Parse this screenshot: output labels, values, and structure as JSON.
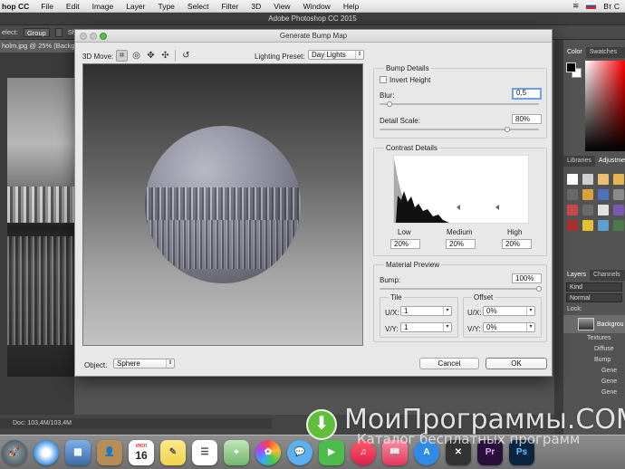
{
  "menubar": {
    "app": "hop CC",
    "items": [
      "File",
      "Edit",
      "Image",
      "Layer",
      "Type",
      "Select",
      "Filter",
      "3D",
      "View",
      "Window",
      "Help"
    ],
    "right_text": "Вт С"
  },
  "ps": {
    "title": "Adobe Photoshop CC 2015",
    "options": {
      "select_label": "elect:",
      "select_value": "Group",
      "show_label": "Sho"
    },
    "doc_tab": "holm.jpg @ 25% (Backgro",
    "status": "Doc: 103,4M/103,4M"
  },
  "panels": {
    "color_tabs": [
      "Color",
      "Swatches"
    ],
    "adjust_tabs": [
      "Libraries",
      "Adjustmen"
    ],
    "layers_tabs": [
      "Layers",
      "Channels"
    ],
    "layers_kind": "Kind",
    "layers_blend": "Normal",
    "layers_lock": "Lock:",
    "layer_background": "Backgrou",
    "layer_sub": [
      "Textures",
      "Diffuse",
      "Bump",
      "Gene",
      "Gene",
      "Gene"
    ],
    "adjust_colors": [
      "#ffffff",
      "#cfcfcf",
      "#e8c070",
      "#e6b450",
      "#6a6a6a",
      "#d9a03c",
      "#4f6fbf",
      "#8a8a8a",
      "#c84a4a",
      "#6b6b6b",
      "#e0e0e0",
      "#7a5ab0",
      "#aa3030",
      "#e6c030",
      "#5ba0d0",
      "#4a7a4a"
    ]
  },
  "dialog": {
    "title": "Generate Bump Map",
    "move_label": "3D Move:",
    "lighting_label": "Lighting Preset:",
    "lighting_value": "Day Lights",
    "object_label": "Object:",
    "object_value": "Sphere",
    "cancel": "Cancel",
    "ok": "OK",
    "bump_details": {
      "title": "Bump Details",
      "invert_label": "Invert Height",
      "invert_checked": false,
      "blur_label": "Blur:",
      "blur_value": "0,5",
      "blur_level": 0.06,
      "detail_label": "Detail Scale:",
      "detail_value": "80%",
      "detail_level": 0.8
    },
    "contrast_details": {
      "title": "Contrast Details",
      "low_label": "Low",
      "low_value": "20%",
      "medium_label": "Medium",
      "medium_value": "20%",
      "high_label": "High",
      "high_value": "20%"
    },
    "material_preview": {
      "title": "Material Preview",
      "bump_label": "Bump:",
      "bump_value": "100%",
      "bump_level": 1.0,
      "tile_title": "Tile",
      "offset_title": "Offset",
      "tile_ux_label": "U/X:",
      "tile_ux_value": "1",
      "tile_vy_label": "V/Y:",
      "tile_vy_value": "1",
      "offset_ux_label": "U/X:",
      "offset_ux_value": "0%",
      "offset_vy_label": "V/Y:",
      "offset_vy_value": "0%"
    }
  },
  "dock": {
    "calendar_month": "ИЮЛ",
    "calendar_day": "16",
    "pr_label": "Pr",
    "ps_label": "Ps"
  },
  "watermark": {
    "title": "МоиПрограммы.СОМ",
    "subtitle": "Каталог бесплатных программ"
  }
}
